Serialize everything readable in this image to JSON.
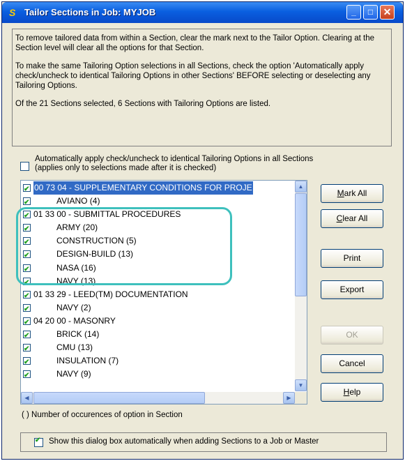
{
  "window": {
    "title": "Tailor Sections in Job: MYJOB",
    "icon": "S",
    "controls": [
      "minimize",
      "maximize",
      "close"
    ]
  },
  "info": {
    "p1": "To remove tailored data from within a Section, clear the mark next to the Tailor Option. Clearing at the Section level will clear all the options for that Section.",
    "p2": "To make the same Tailoring Option selections in all Sections, check the option 'Automatically apply check/uncheck to identical Tailoring Options in other Sections' BEFORE selecting or deselecting any Tailoring Options.",
    "p3": "Of the 21 Sections selected, 6 Sections with Tailoring Options are listed."
  },
  "auto_apply": {
    "line1": "Automatically apply check/uncheck to identical Tailoring Options in all Sections",
    "line2": "(applies only to selections made after it is checked)",
    "checked": false
  },
  "list": [
    {
      "label": "00 73 04 - SUPPLEMENTARY CONDITIONS FOR PROJE",
      "child": false,
      "checked": true,
      "selected": true
    },
    {
      "label": "AVIANO   (4)",
      "child": true,
      "checked": true
    },
    {
      "label": "01 33 00 - SUBMITTAL PROCEDURES",
      "child": false,
      "checked": true
    },
    {
      "label": "ARMY   (20)",
      "child": true,
      "checked": true
    },
    {
      "label": "CONSTRUCTION   (5)",
      "child": true,
      "checked": true
    },
    {
      "label": "DESIGN-BUILD   (13)",
      "child": true,
      "checked": true
    },
    {
      "label": "NASA   (16)",
      "child": true,
      "checked": true
    },
    {
      "label": "NAVY   (13)",
      "child": true,
      "checked": true
    },
    {
      "label": "01 33 29 - LEED(TM) DOCUMENTATION",
      "child": false,
      "checked": true
    },
    {
      "label": "NAVY   (2)",
      "child": true,
      "checked": true
    },
    {
      "label": "04 20 00 - MASONRY",
      "child": false,
      "checked": true
    },
    {
      "label": "BRICK   (14)",
      "child": true,
      "checked": true
    },
    {
      "label": "CMU   (13)",
      "child": true,
      "checked": true
    },
    {
      "label": "INSULATION   (7)",
      "child": true,
      "checked": true
    },
    {
      "label": "NAVY   (9)",
      "child": true,
      "checked": true
    }
  ],
  "buttons": {
    "mark_all": {
      "key": "M",
      "rest": "ark All"
    },
    "clear_all": {
      "key": "C",
      "rest": "lear All"
    },
    "print": "Print",
    "export": "Export",
    "ok": "OK",
    "cancel": "Cancel",
    "help": {
      "key": "H",
      "rest": "elp"
    }
  },
  "footnote": "( ) Number of occurences of option in Section",
  "show_dialog": {
    "label": "Show this dialog box automatically when adding Sections to a Job or Master",
    "checked": true
  },
  "colors": {
    "highlight_annotation": "#3ec0bd",
    "selection": "#316ac5",
    "title_bar": "#0a5fe0"
  }
}
